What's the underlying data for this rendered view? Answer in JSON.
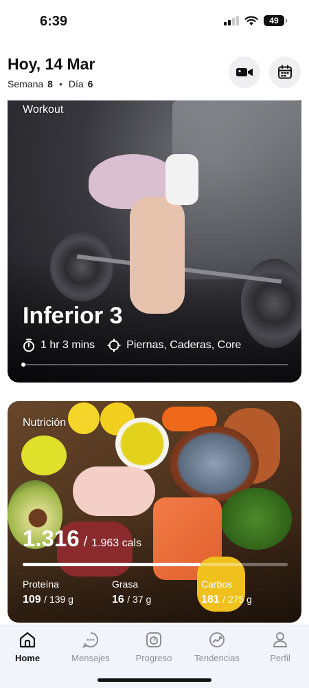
{
  "status_bar": {
    "time": "6:39",
    "battery": "49"
  },
  "header": {
    "date": "Hoy, 14 Mar",
    "week_label": "Semana",
    "week": "8",
    "day_label": "Día",
    "day": "6",
    "icons": [
      "video-camera-icon",
      "calendar-icon"
    ]
  },
  "workout": {
    "label": "Workout",
    "title": "Inferior 3",
    "duration": "1 hr 3 mins",
    "targets": "Piernas, Caderas, Core"
  },
  "nutrition": {
    "label": "Nutrición",
    "calories": "1.316",
    "calorie_goal": "1.963 cals",
    "calorie_progress": 0.67,
    "macros": [
      {
        "name": "Proteína",
        "value": "109",
        "goal": "139 g"
      },
      {
        "name": "Grasa",
        "value": "16",
        "goal": "37 g"
      },
      {
        "name": "Carbos",
        "value": "181",
        "goal": "275 g"
      }
    ]
  },
  "nav": {
    "active": "Home",
    "items": [
      {
        "label": "Home",
        "icon": "home-icon"
      },
      {
        "label": "Mensajes",
        "icon": "chat-icon"
      },
      {
        "label": "Progreso",
        "icon": "scale-icon"
      },
      {
        "label": "Tendencias",
        "icon": "trend-icon"
      },
      {
        "label": "Perfil",
        "icon": "user-icon"
      }
    ]
  },
  "colors": {
    "nav_bg": "#f1f5fb",
    "nav_inactive": "#8e8e93",
    "header_button_bg": "#efeff1"
  }
}
